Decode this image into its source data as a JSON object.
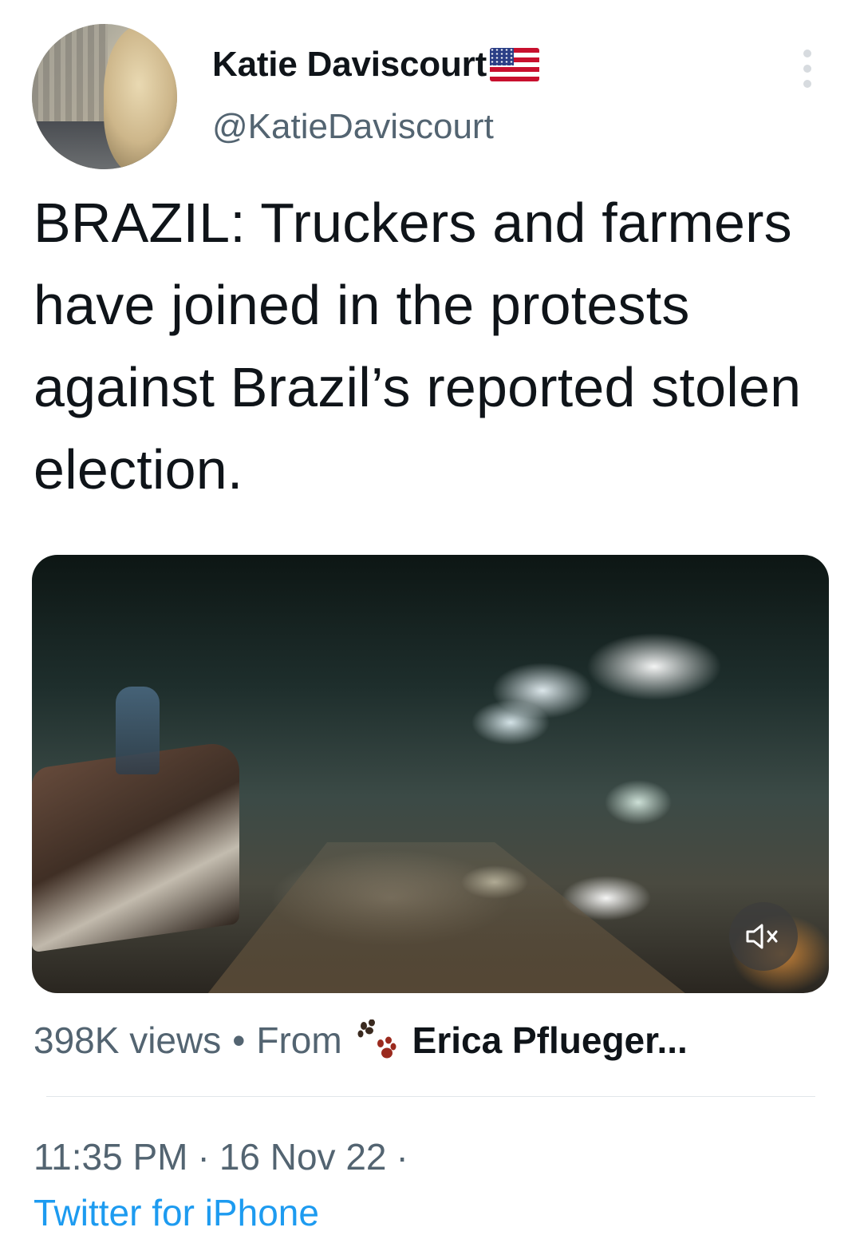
{
  "author": {
    "display_name": "Katie Daviscourt",
    "handle": "@KatieDaviscourt",
    "badge_icon": "us-flag-icon"
  },
  "tweet": {
    "text": "BRAZIL: Truckers and farmers have joined in the protests against Brazil’s reported stolen election."
  },
  "media": {
    "type": "video",
    "mute_icon": "muted-speaker-icon"
  },
  "stats": {
    "views": "398K views",
    "separator": "•",
    "from_label": "From",
    "source_icon": "paw-print-icon",
    "source_name": "Erica Pflueger..."
  },
  "meta": {
    "time": "11:35 PM",
    "separator": "·",
    "date": "16 Nov 22",
    "client": "Twitter for iPhone"
  },
  "colors": {
    "text_primary": "#0f1419",
    "text_secondary": "#536471",
    "link": "#1d9bf0",
    "divider": "#e1e6ea"
  }
}
